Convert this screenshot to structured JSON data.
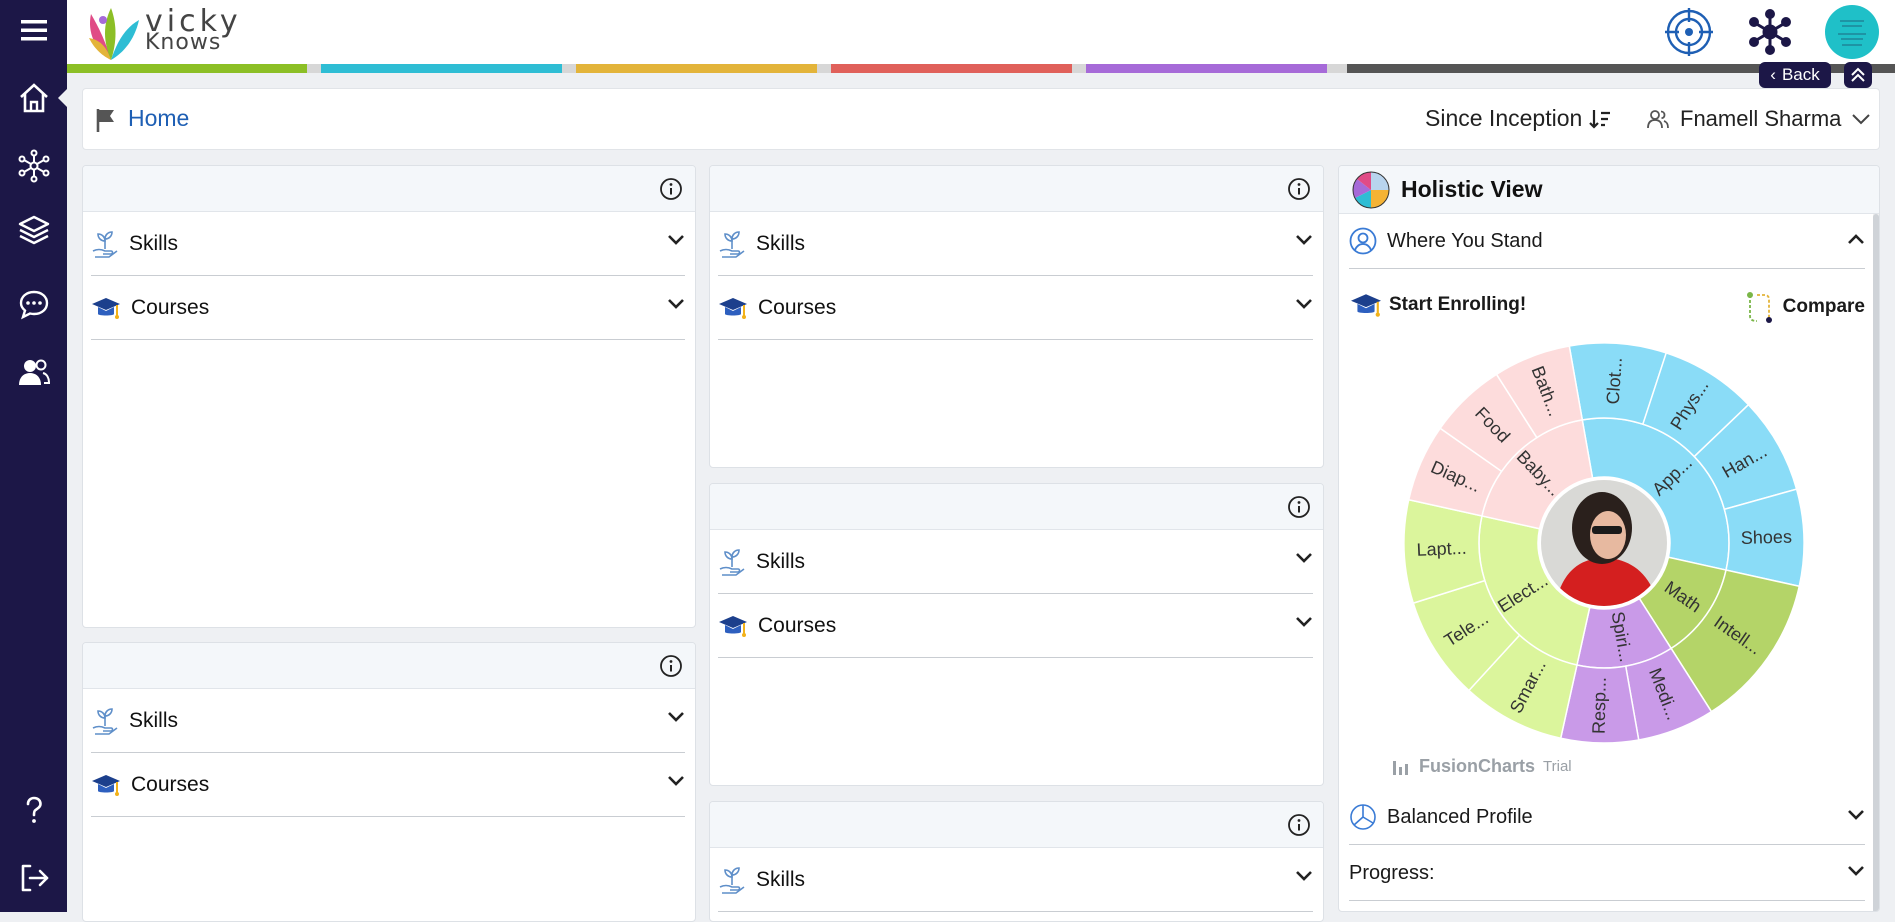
{
  "app": {
    "logo_line1": "vicky",
    "logo_line2": "Knows"
  },
  "colors": {
    "sidebar": "#1c1747",
    "strip": [
      "#8cbf26",
      "#2ebdd4",
      "#e3b43a",
      "#e0605a",
      "#a66ad8",
      "#555555"
    ],
    "link": "#1e5fb4"
  },
  "sidebar": {
    "items": [
      "menu-icon",
      "home-icon",
      "network-icon",
      "layers-icon",
      "chat-icon",
      "users-icon",
      "help-icon",
      "logout-icon"
    ]
  },
  "nav": {
    "back_label": "Back"
  },
  "breadcrumb": {
    "home_label": "Home",
    "period_label": "Since Inception",
    "user_name": "Fnamell Sharma"
  },
  "cards": {
    "skills_label": "Skills",
    "courses_label": "Courses"
  },
  "holistic": {
    "title": "Holistic View",
    "where_you_stand": "Where You Stand",
    "start_enrolling": "Start Enrolling!",
    "compare": "Compare",
    "balanced_profile": "Balanced Profile",
    "progress": "Progress:",
    "watermark": "FusionCharts",
    "watermark_suffix": "Trial"
  },
  "chart_data": {
    "type": "sunburst",
    "inner_ring": [
      {
        "label": "App...",
        "color": "#8adcf7",
        "value": 5
      },
      {
        "label": "Math",
        "color": "#b4d468",
        "value": 2
      },
      {
        "label": "Spiri...",
        "color": "#c99ae8",
        "value": 2
      },
      {
        "label": "Elect...",
        "color": "#dbf59c",
        "value": 4
      },
      {
        "label": "Baby...",
        "color": "#fddcdc",
        "value": 3
      }
    ],
    "outer_ring": [
      {
        "label": "Clot...",
        "parent": "App...",
        "value": 1
      },
      {
        "label": "Phys...",
        "parent": "App...",
        "value": 1
      },
      {
        "label": "Han...",
        "parent": "App...",
        "value": 1
      },
      {
        "label": "Shoes",
        "parent": "App...",
        "value": 1
      },
      {
        "label": "Intell...",
        "parent": "Math",
        "value": 2
      },
      {
        "label": "Medi...",
        "parent": "Spiri...",
        "value": 1
      },
      {
        "label": "Resp...",
        "parent": "Spiri...",
        "value": 1
      },
      {
        "label": "Smar...",
        "parent": "Elect...",
        "value": 1
      },
      {
        "label": "Tele...",
        "parent": "Elect...",
        "value": 1
      },
      {
        "label": "Lapt...",
        "parent": "Elect...",
        "value": 1
      },
      {
        "label": "Diap...",
        "parent": "Baby...",
        "value": 1
      },
      {
        "label": "Food",
        "parent": "Baby...",
        "value": 1
      },
      {
        "label": "Bath...",
        "parent": "Baby...",
        "value": 1
      }
    ]
  }
}
